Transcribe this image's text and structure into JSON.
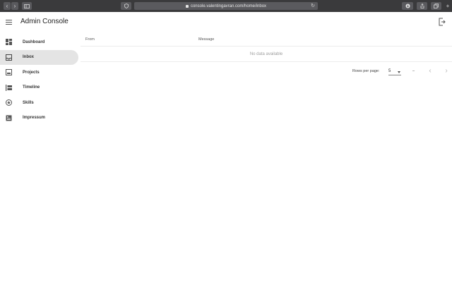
{
  "browser": {
    "url": "console.valentingavran.com/home/inbox"
  },
  "header": {
    "title": "Admin Console"
  },
  "sidebar": {
    "items": [
      {
        "label": "Dashboard",
        "icon": "dashboard-icon",
        "active": false
      },
      {
        "label": "Inbox",
        "icon": "inbox-icon",
        "active": true
      },
      {
        "label": "Projects",
        "icon": "projects-icon",
        "active": false
      },
      {
        "label": "Timeline",
        "icon": "timeline-icon",
        "active": false
      },
      {
        "label": "Skills",
        "icon": "skills-icon",
        "active": false
      },
      {
        "label": "Impressum",
        "icon": "impressum-icon",
        "active": false
      }
    ]
  },
  "table": {
    "columns": [
      "From",
      "Message"
    ],
    "empty_text": "No data available"
  },
  "pagination": {
    "rows_per_page_label": "Rows per page:",
    "rows_per_page_value": "5",
    "range_text": "–"
  },
  "colors": {
    "browser_chrome": "#3a3a3c",
    "active_item_bg": "#e4e4e4",
    "text_primary": "#222222",
    "text_muted": "#9e9e9e"
  }
}
